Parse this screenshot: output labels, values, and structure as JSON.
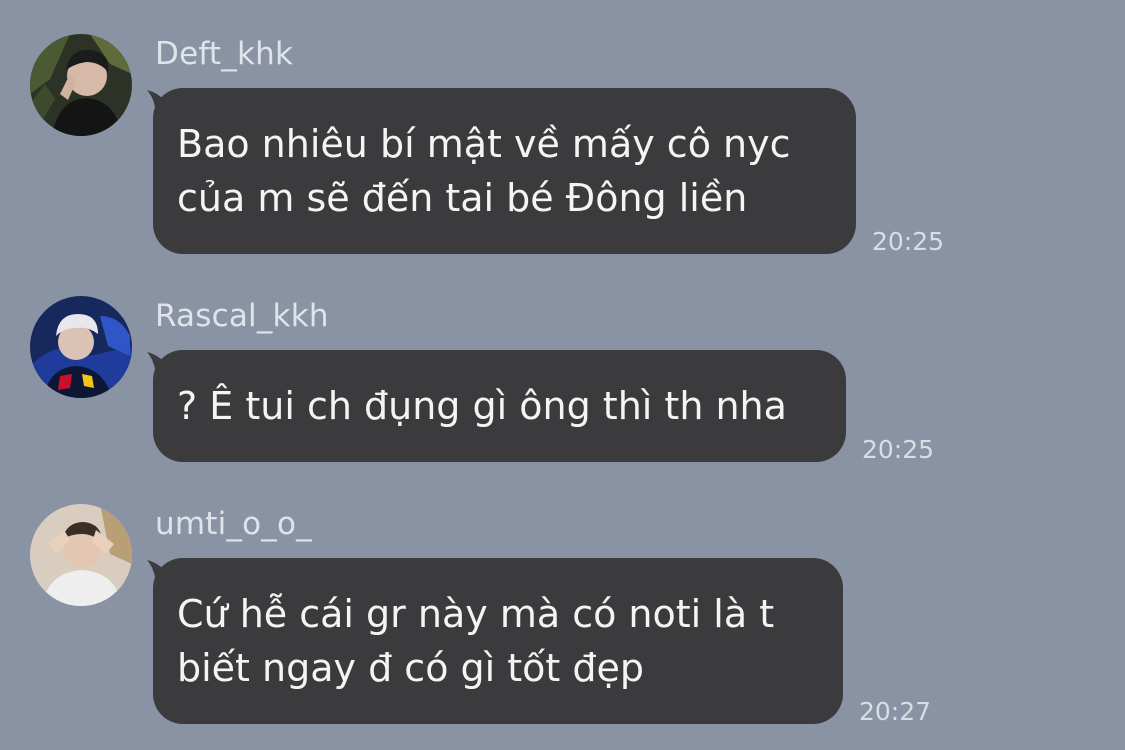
{
  "messages": [
    {
      "sender": "Deft_khk",
      "avatar_icon": "profile-photo-dark-green",
      "lines": [
        "Bao nhiêu bí mật về mấy cô nyc",
        "của m sẽ đến tai bé Đông liền"
      ],
      "time": "20:25"
    },
    {
      "sender": "Rascal_kkh",
      "avatar_icon": "profile-photo-blue",
      "lines": [
        "? Ê tui ch đụng gì ông thì th nha"
      ],
      "time": "20:25"
    },
    {
      "sender": "umti_o_o_",
      "avatar_icon": "profile-photo-light",
      "lines": [
        "Cứ hễ cái gr này mà có noti là t",
        "biết ngay đ có gì tốt đẹp"
      ],
      "time": "20:27"
    }
  ],
  "colors": {
    "background": "#8a93a3",
    "bubble": "#3b3b3d",
    "bubble_text": "#f4f4f4",
    "meta_text": "#dfe3ea"
  }
}
